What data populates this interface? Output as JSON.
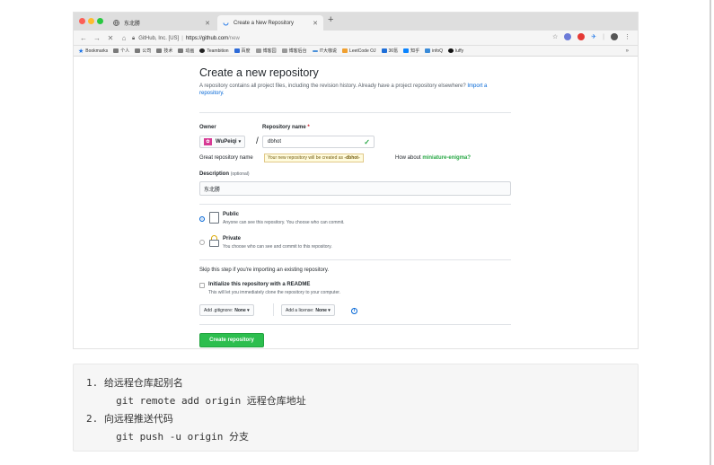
{
  "browser": {
    "tabs": [
      {
        "title": "东北勝",
        "active": false
      },
      {
        "title": "Create a New Repository",
        "active": true
      }
    ],
    "omnibox": {
      "org": "GitHub, Inc. [US]",
      "separator": "|",
      "url_host": "https://github.com",
      "url_path": "/new"
    },
    "bookmarks": [
      "Bookmarks",
      "个人",
      "公司",
      "技术",
      "动画",
      "Teambition",
      "百度",
      "博客园",
      "博客后台",
      "IT大咖说",
      "LeetCode OJ",
      "36氪",
      "知乎",
      "infoQ",
      "luffy"
    ],
    "bookmarks_more": "»"
  },
  "form": {
    "title": "Create a new repository",
    "lead": "A repository contains all project files, including the revision history. Already have a project repository elsewhere?",
    "import_link": "Import a repository.",
    "owner_label": "Owner",
    "repo_label": "Repository name",
    "required_mark": "*",
    "owner_value": "WuPeiqi",
    "slash": "/",
    "repo_value": "dbhot",
    "great_prefix": "Great repository name",
    "tooltip_prefix": "Your new repository will be created as",
    "tooltip_name": "-dbhot-",
    "suggestion_prefix": "How about",
    "suggestion_name": "miniature-enigma?",
    "description_label": "Description",
    "description_optional": "(optional)",
    "description_value": "东北勝",
    "public_title": "Public",
    "public_sub": "Anyone can see this repository. You choose who can commit.",
    "private_title": "Private",
    "private_sub": "You choose who can see and commit to this repository.",
    "skip_text": "Skip this step if you're importing an existing repository.",
    "readme_title": "Initialize this repository with a README",
    "readme_sub": "This will let you immediately clone the repository to your computer.",
    "gitignore_label": "Add .gitignore:",
    "gitignore_value": "None ▾",
    "license_label": "Add a license:",
    "license_value": "None ▾",
    "info_glyph": "i",
    "create_button": "Create repository"
  },
  "notes": {
    "lines": [
      "1. 给远程仓库起别名",
      "     git remote add origin 远程仓库地址",
      "2. 向远程推送代码",
      "     git push -u origin 分支"
    ]
  }
}
